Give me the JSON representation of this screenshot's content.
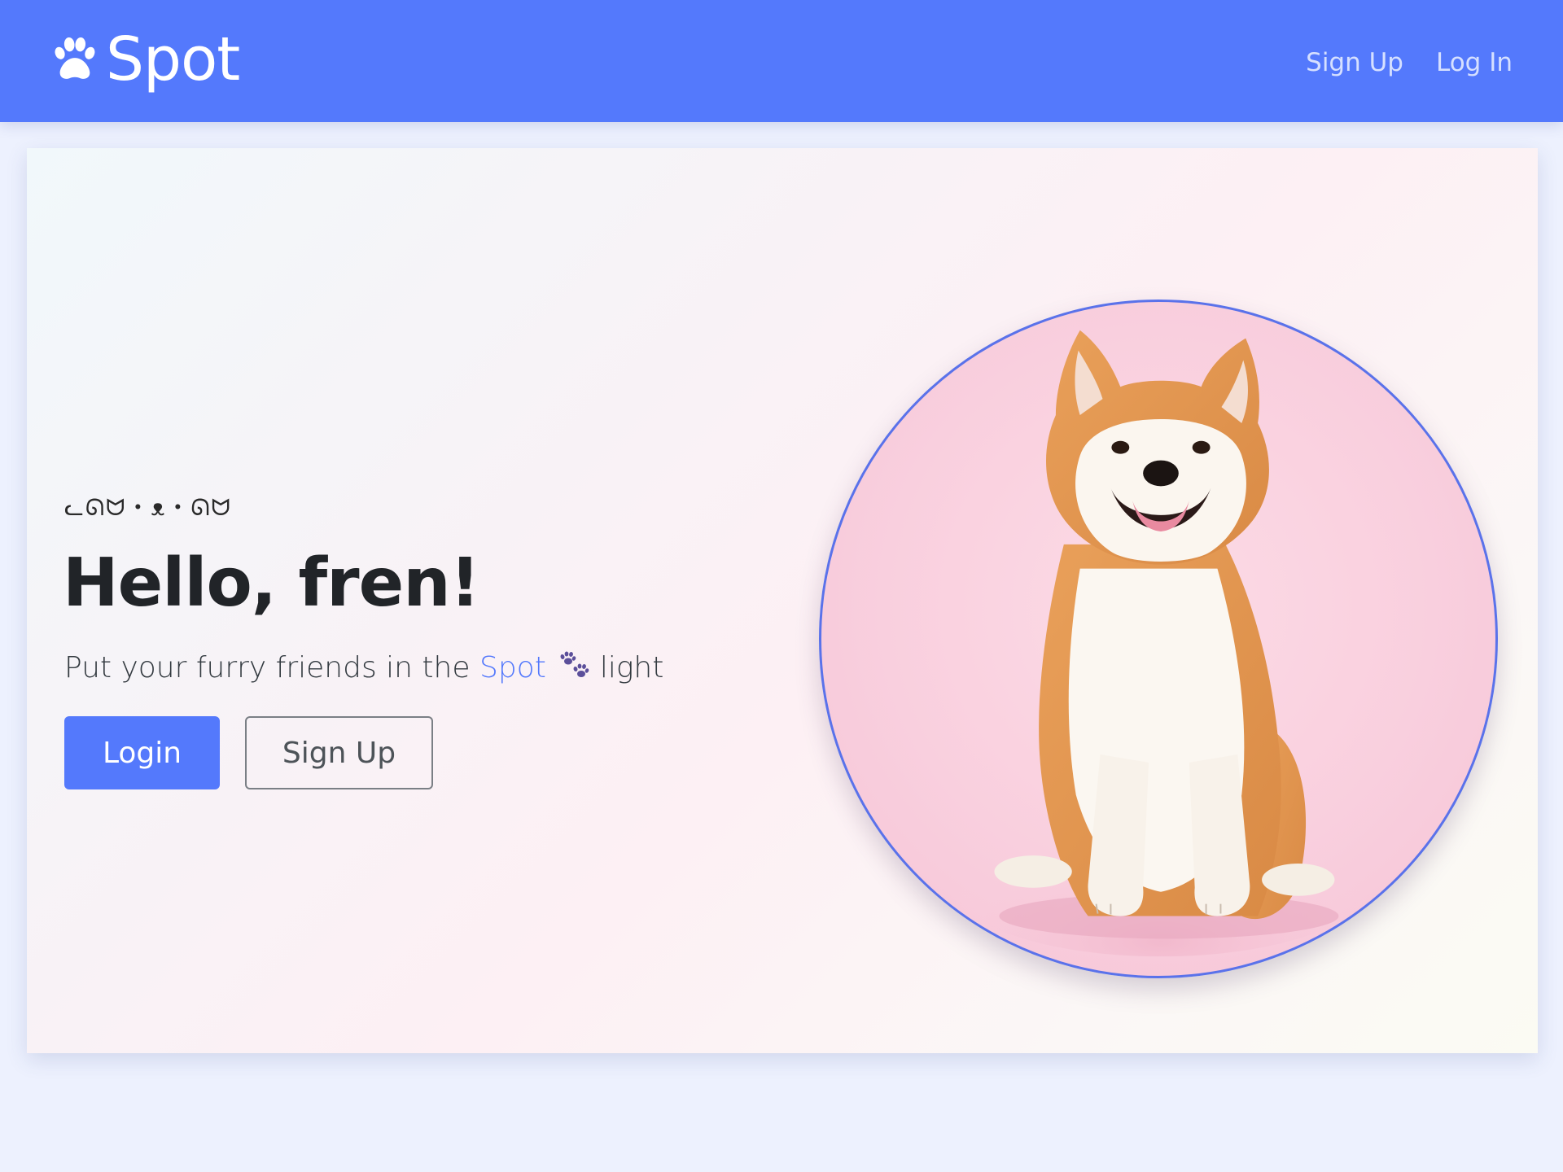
{
  "navbar": {
    "brand_name": "Spot",
    "brand_icon": "paw-icon",
    "links": [
      {
        "label": "Sign Up"
      },
      {
        "label": "Log In"
      }
    ]
  },
  "hero": {
    "kaomoji": "ᓚᘏᗢ・ᴥ・ᘏᗢ",
    "title": "Hello, fren!",
    "subtitle_before": "Put your furry friends in the",
    "subtitle_highlight": "Spot",
    "subtitle_icon": "paw-prints-icon",
    "subtitle_after": "light",
    "login_button": "Login",
    "signup_button": "Sign Up",
    "image": "shiba-inu-dog-photo"
  },
  "colors": {
    "primary": "#5479fc",
    "nav_link": "#d6e0ff",
    "heading": "#212428",
    "page_bg": "#edf1fe",
    "photo_bg": "#f9cfde",
    "circle_border": "#5a72ea"
  }
}
